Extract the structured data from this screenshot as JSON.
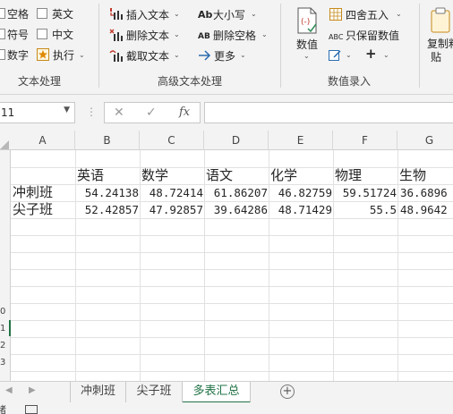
{
  "ribbon": {
    "text_group": {
      "title": "文本处理",
      "items": [
        "空格",
        "英文",
        "符号",
        "中文",
        "数字",
        "执行"
      ]
    },
    "advanced_group": {
      "title": "高级文本处理",
      "insert_text": "插入文本",
      "delete_text": "删除文本",
      "extract_text": "截取文本",
      "case": "大小写",
      "case_icon": "Ab",
      "delete_space": "删除空格",
      "delete_space_icon": "AB",
      "more": "更多"
    },
    "numeric_group": {
      "title": "数值录入",
      "value": "数值",
      "round": "四舍五入",
      "keep_value": "只保留数值",
      "keep_value_icon": "ABC",
      "plus": "+"
    },
    "copy_group": {
      "copy_label_line1": "复制粘",
      "copy_label_line2": "贴"
    }
  },
  "formula_bar": {
    "name_box": "11",
    "cancel": "✕",
    "enter": "✓",
    "fx": "fx",
    "value": ""
  },
  "columns": [
    "A",
    "B",
    "C",
    "D",
    "E",
    "F",
    "G"
  ],
  "row_numbers": [
    "",
    "",
    "",
    "",
    "",
    "",
    "",
    "",
    "",
    "0",
    "1",
    "2",
    "3"
  ],
  "table": {
    "headers": [
      "英语",
      "数学",
      "语文",
      "化学",
      "物理",
      "生物"
    ],
    "rows": [
      {
        "label": "冲刺班",
        "values": [
          "54.24138",
          "48.72414",
          "61.86207",
          "46.82759",
          "59.51724",
          "36.6896"
        ]
      },
      {
        "label": "尖子班",
        "values": [
          "52.42857",
          "47.92857",
          "39.64286",
          "48.71429",
          "55.5",
          "48.9642"
        ]
      }
    ]
  },
  "sheets": {
    "tabs": [
      "冲刺班",
      "尖子班",
      "多表汇总"
    ],
    "active": "多表汇总",
    "add": "+"
  },
  "status_bar": {
    "left_text": "绪"
  },
  "colors": {
    "accent": "#217346",
    "ribbon_bg": "#f3f3f3",
    "icon_red": "#c0392b",
    "icon_blue": "#2b6cb0"
  }
}
